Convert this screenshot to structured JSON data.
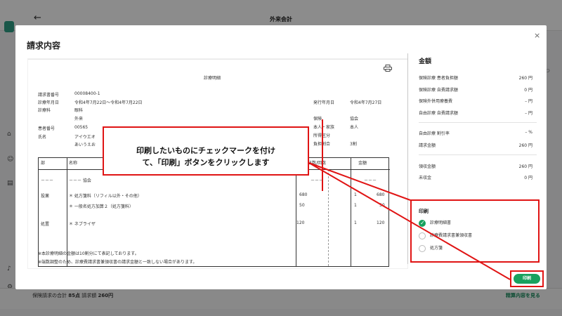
{
  "app": {
    "title": "外来会計",
    "bottom_total_label": "保険請求の合計",
    "bottom_total_value": "85点",
    "bottom_claim_label": "請求額",
    "bottom_claim_value": "260円",
    "bottom_link": "精算内容を見る",
    "right_peek": "つ"
  },
  "modal": {
    "title": "請求内容",
    "close": "×"
  },
  "document": {
    "title": "診療明細",
    "fields": {
      "invoice_no_label": "請求書番号",
      "invoice_no": "00008400-1",
      "date_label": "診療年月日",
      "date": "令和4年7月22日～令和4年7月22日",
      "dept_label": "診療科",
      "dept": "眼科",
      "outpatient": "外来",
      "issue_label": "発行年月日",
      "issue_date": "令和4年7月27日",
      "insurance_label": "保険",
      "insurance": "協会",
      "patient_no_label": "患者番号",
      "patient_no": "00565",
      "name_label": "氏名",
      "name_kana": "アイウエオ",
      "name": "あいうえお",
      "self_family_label": "本人・家族",
      "self_family": "本人",
      "income_label": "所得区分",
      "burden_label": "負担割合",
      "burden": "3割"
    },
    "table": {
      "headers": [
        "部",
        "名称",
        "日数/回数",
        "金額"
      ],
      "row_dash": "－－－",
      "row_dash_name": "－－－ 協会",
      "rows": [
        {
          "part": "投薬",
          "name": "＊ 処方箋料（リフィル以外・その他）",
          "points": "680",
          "count": "1",
          "amount": "680"
        },
        {
          "part": "",
          "name": "＊ 一般名処方加算２（処方箋料）",
          "points": "50",
          "count": "1",
          "amount": "50"
        },
        {
          "part": "処置",
          "name": "＊ ネブライザ",
          "points": "120",
          "count": "1",
          "amount": "120"
        }
      ]
    },
    "notes": [
      "※本診療明細の金額は10割分にて表記しております。",
      "※端数調整のため、診療費請求書兼領収書の請求金額と一致しない場合があります。"
    ]
  },
  "amounts": {
    "title": "金額",
    "rows": [
      {
        "label": "保険診療 患者負担額",
        "value": "260 円"
      },
      {
        "label": "保険診療 自費請求額",
        "value": "0 円"
      },
      {
        "label": "保険外併用療養費",
        "value": "– 円"
      },
      {
        "label": "自由診療 自費請求額",
        "value": "– 円"
      },
      {
        "label": "自由診療 割引率",
        "value": "– %"
      },
      {
        "label": "請求金額",
        "value": "260 円"
      },
      {
        "label": "領収金額",
        "value": "260 円"
      },
      {
        "label": "未収金",
        "value": "0 円"
      }
    ]
  },
  "print": {
    "title": "印刷",
    "options": [
      {
        "label": "診療明細書",
        "checked": true
      },
      {
        "label": "診療費請求書兼領収書",
        "checked": false
      },
      {
        "label": "処方箋",
        "checked": false
      }
    ],
    "button": "印刷"
  },
  "callout": {
    "line1": "印刷したいものにチェックマークを付け",
    "line2": "て、「印刷」ボタンをクリックします"
  },
  "colors": {
    "accent": "#19a15e",
    "highlight": "#e01414"
  }
}
